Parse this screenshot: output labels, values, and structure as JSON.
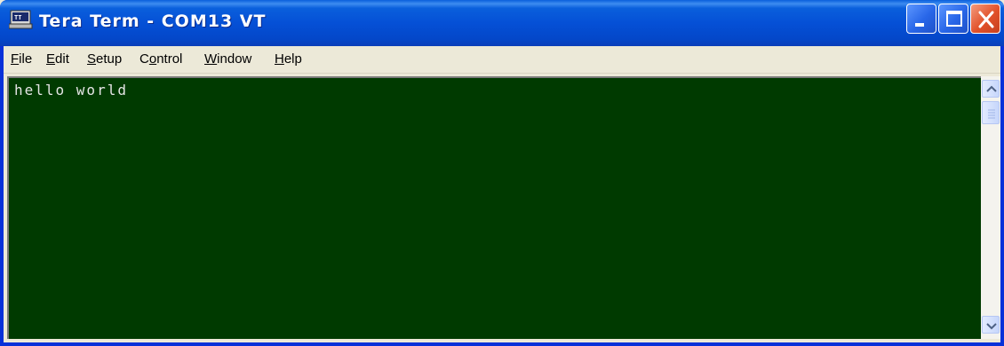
{
  "window": {
    "title": "Tera Term - COM13 VT",
    "icon": "tera-term-app-icon",
    "controls": [
      "minimize-icon",
      "maximize-icon",
      "close-icon"
    ]
  },
  "menu": {
    "items": [
      {
        "label": "File",
        "mnemonic": "F",
        "rest": "ile"
      },
      {
        "label": "Edit",
        "mnemonic": "E",
        "rest": "dit"
      },
      {
        "label": "Setup",
        "mnemonic": "S",
        "rest": "etup"
      },
      {
        "label": "Control",
        "pre": "C",
        "mnemonic": "o",
        "rest": "ntrol"
      },
      {
        "label": "Window",
        "mnemonic": "W",
        "rest": "indow"
      },
      {
        "label": "Help",
        "mnemonic": "H",
        "rest": "elp"
      }
    ]
  },
  "terminal": {
    "output": "hello world",
    "colors": {
      "background": "#003a00",
      "foreground": "#e6e6e6"
    }
  },
  "scrollbar": {
    "icons": [
      "scroll-up-arrow-icon",
      "scroll-thumb-grip-icon",
      "scroll-down-arrow-icon"
    ]
  },
  "colors": {
    "titlebar": "#0550d6",
    "close_button": "#e1512a",
    "menubar": "#ece9d8"
  }
}
